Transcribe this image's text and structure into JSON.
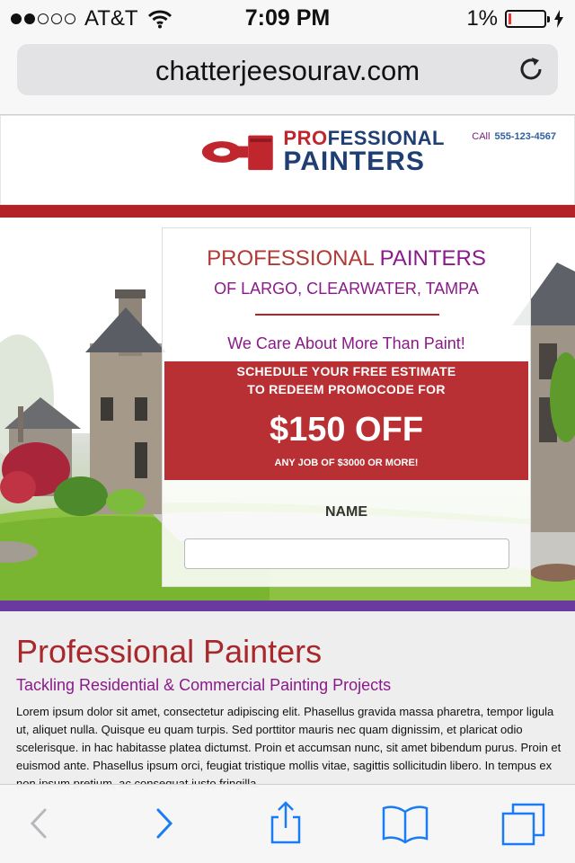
{
  "status_bar": {
    "carrier": "AT&T",
    "signal_bars_filled": 2,
    "signal_bars_total": 5,
    "time": "7:09 PM",
    "battery_percent": "1%",
    "battery_level": 0.01,
    "charging": true
  },
  "browser": {
    "url": "chatterjeesourav.com"
  },
  "header": {
    "logo_pro_red": "PRO",
    "logo_pro_blue": "FESSIONAL",
    "logo_painters": "PAINTERS",
    "call_label": "CAll",
    "call_number": "555-123-4567"
  },
  "promo": {
    "title_part1": "PROFESSIONAL",
    "title_part2": "PAINTERS",
    "subtitle": "OF LARGO, CLEARWATER, TAMPA",
    "tagline": "We Care About More Than Paint!",
    "schedule_line1": "SCHEDULE YOUR FREE ESTIMATE",
    "schedule_line2": "TO REDEEM PROMOCODE FOR",
    "offer": "$150 OFF",
    "offer_note": "ANY JOB OF $3000 OR MORE!",
    "name_label": "NAME",
    "name_value": ""
  },
  "content": {
    "heading": "Professional Painters",
    "subheading": "Tackling Residential & Commercial Painting Projects",
    "body": "Lorem ipsum dolor sit amet, consectetur adipiscing elit. Phasellus gravida massa pharetra, tempor ligula ut, aliquet nulla. Quisque eu quam turpis. Sed porttitor mauris nec quam dignissim, et plaricat odio scelerisque. in hac habitasse platea dictumst. Proin et accumsan nunc, sit amet bibendum purus. Proin et euismod ante. Phasellus ipsum orci, feugiat tristique mollis vitae, sagittis sollicitudin libero. In tempus ex non ipsum pretium, ac consequat justo fringilla."
  },
  "colors": {
    "brand_red": "#b32227",
    "brand_purple": "#8a1a8a",
    "brand_blue": "#1f3e73",
    "accent_bar": "#6b3aa0",
    "ios_blue": "#1a7cf5"
  },
  "toolbar": {
    "icons": [
      "back-icon",
      "forward-icon",
      "share-icon",
      "bookmarks-icon",
      "tabs-icon"
    ]
  }
}
